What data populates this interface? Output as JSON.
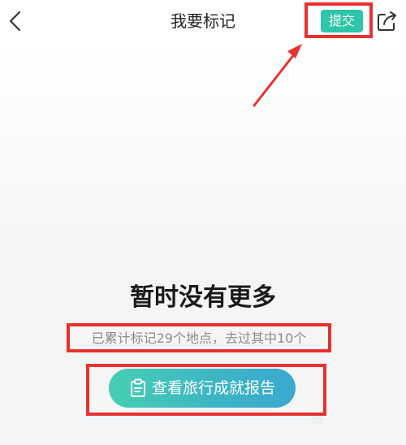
{
  "header": {
    "title": "我要标记",
    "submit_label": "提交",
    "back_icon": "chevron-left-icon",
    "share_icon": "share-icon"
  },
  "empty_state": {
    "title": "暂时没有更多",
    "stats": "已累计标记29个地点，去过其中10个"
  },
  "report_button": {
    "label": "查看旅行成就报告",
    "icon": "clipboard-icon"
  },
  "colors": {
    "accent": "#2ec6a8",
    "button_gradient_start": "#46cfb2",
    "button_gradient_end": "#3aa9cf",
    "annotation": "#e8312f"
  }
}
